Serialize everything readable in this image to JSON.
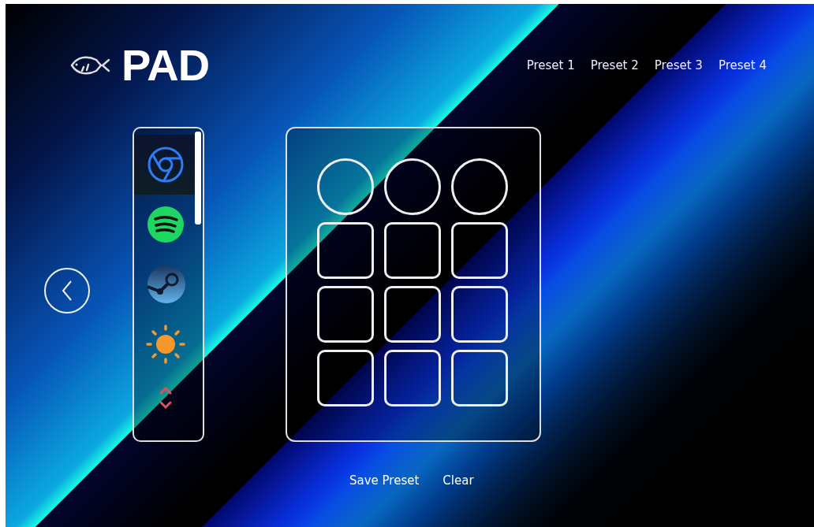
{
  "logo": {
    "text": "PAD"
  },
  "presets": [
    {
      "label": "Preset 1"
    },
    {
      "label": "Preset 2"
    },
    {
      "label": "Preset 3"
    },
    {
      "label": "Preset 4"
    }
  ],
  "sidebar": {
    "items": [
      {
        "kind": "browser",
        "selected": true
      },
      {
        "kind": "music",
        "selected": false
      },
      {
        "kind": "game",
        "selected": false
      },
      {
        "kind": "brightness",
        "selected": false
      },
      {
        "kind": "arrows",
        "selected": false
      }
    ]
  },
  "pad": {
    "buttons": [
      {
        "kind": "round"
      },
      {
        "kind": "round"
      },
      {
        "kind": "round"
      },
      {
        "kind": "square"
      },
      {
        "kind": "square"
      },
      {
        "kind": "square"
      },
      {
        "kind": "square"
      },
      {
        "kind": "square"
      },
      {
        "kind": "square"
      },
      {
        "kind": "square"
      },
      {
        "kind": "square"
      },
      {
        "kind": "square"
      }
    ]
  },
  "actions": [
    {
      "label": "Save Preset"
    },
    {
      "label": "Clear"
    }
  ]
}
